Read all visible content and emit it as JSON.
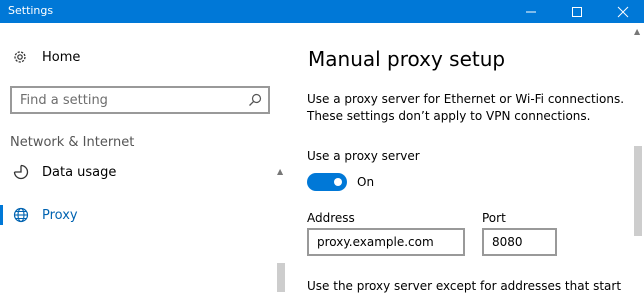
{
  "window": {
    "title": "Settings"
  },
  "sidebar": {
    "home_label": "Home",
    "search": {
      "placeholder": "Find a setting"
    },
    "section_header": "Network & Internet",
    "items": [
      {
        "label": "Data usage",
        "icon": "data-usage-icon",
        "selected": false
      },
      {
        "label": "Proxy",
        "icon": "globe-icon",
        "selected": true
      }
    ]
  },
  "main": {
    "page_title": "Manual proxy setup",
    "description": "Use a proxy server for Ethernet or Wi-Fi connections. These settings don’t apply to VPN connections.",
    "use_proxy_label": "Use a proxy server",
    "toggle": {
      "state": "On",
      "on": true
    },
    "address_label": "Address",
    "address_value": "proxy.example.com",
    "port_label": "Port",
    "port_value": "8080",
    "exceptions_text": "Use the proxy server except for addresses that start"
  },
  "colors": {
    "accent": "#0078d7",
    "selected_text": "#0063b1"
  }
}
